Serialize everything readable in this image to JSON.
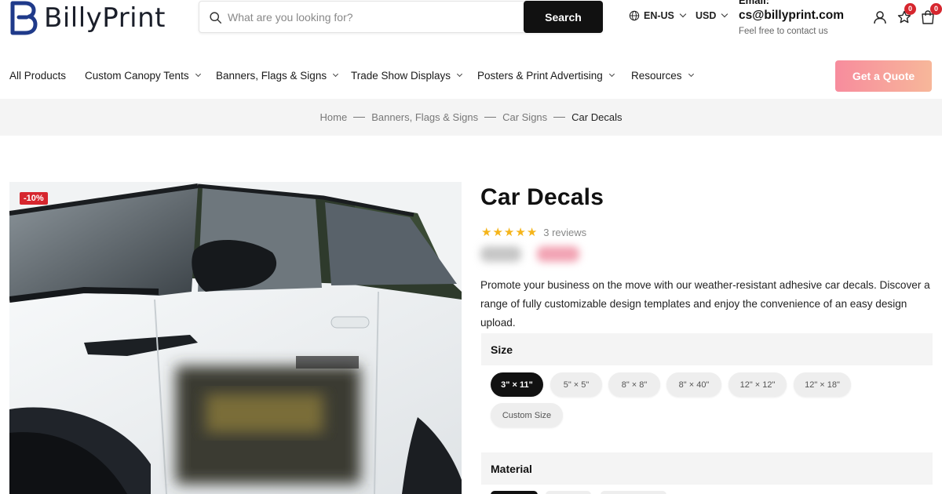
{
  "header": {
    "brand": "BillyPrint",
    "search_placeholder": "What are you looking for?",
    "search_button": "Search",
    "language": "EN-US",
    "currency": "USD",
    "contact_label": "Email:",
    "contact_email": "cs@billyprint.com",
    "contact_sub": "Feel free to contact us",
    "wishlist_count": "0",
    "cart_count": "0"
  },
  "nav": {
    "items": [
      {
        "label": "All Products"
      },
      {
        "label": "Custom Canopy Tents"
      },
      {
        "label": "Banners, Flags & Signs"
      },
      {
        "label": "Trade Show Displays"
      },
      {
        "label": "Posters & Print Advertising"
      },
      {
        "label": "Resources"
      }
    ],
    "quote_button": "Get a Quote"
  },
  "breadcrumb": [
    "Home",
    "Banners, Flags & Signs",
    "Car Signs",
    "Car Decals"
  ],
  "product": {
    "discount": "-10%",
    "title": "Car Decals",
    "rating": 5,
    "reviews": "3 reviews",
    "description": "Promote your business on the move with our weather-resistant adhesive car decals. Discover a range of fully customizable design templates and enjoy the convenience of an easy design upload.",
    "size_label": "Size",
    "sizes": [
      "3\" × 11\"",
      "5\" × 5\"",
      "8\" × 8\"",
      "8\" × 40\"",
      "12\" × 12\"",
      "12\" × 18\"",
      "Custom Size"
    ],
    "selected_size": "3\" × 11\"",
    "material_label": "Material"
  },
  "colors": {
    "accent": "#111111",
    "badge": "#d6262e",
    "star": "#f5b51b",
    "quote_gradient_start": "#f78c9d",
    "quote_gradient_end": "#f7b79a",
    "brand_blue": "#1f3a8a"
  }
}
